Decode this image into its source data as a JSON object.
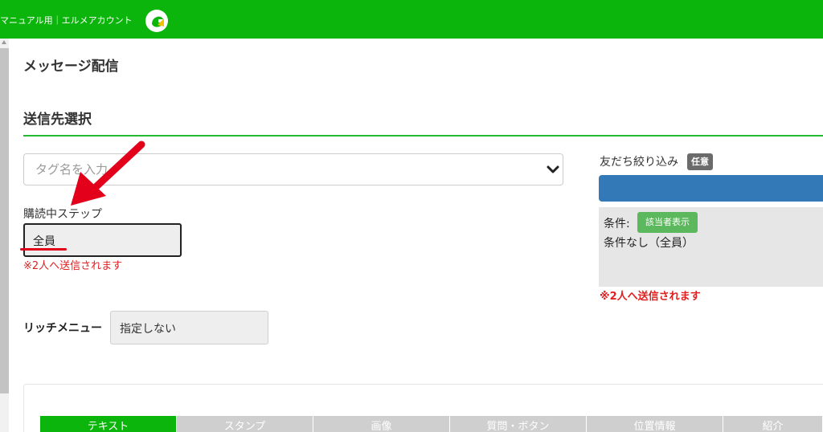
{
  "header": {
    "account_name": "マニュアル用｜エルメアカウント",
    "logo_icon": "l-message-logo-icon",
    "bar_color": "#0bb50b"
  },
  "page": {
    "title": "メッセージ配信",
    "section_title": "送信先選択"
  },
  "recipients": {
    "tag_placeholder": "タグ名を入力",
    "tag_dropdown_icon": "chevron-down-icon",
    "step_label": "購読中ステップ",
    "step_value": "全員",
    "step_note": "※2人へ送信されます"
  },
  "friends_filter": {
    "label": "友だち絞り込み",
    "optional_badge": "任意",
    "condition_label": "条件:",
    "show_targets_button": "該当者表示",
    "condition_value": "条件なし（全員）",
    "note": "※2人へ送信されます",
    "accent_color": "#3479b7"
  },
  "rich_menu": {
    "label": "リッチメニュー",
    "value": "指定しない"
  },
  "composer": {
    "tabs": [
      {
        "label": "テキスト",
        "active": true
      },
      {
        "label": "スタンプ",
        "active": false
      },
      {
        "label": "画像",
        "active": false
      },
      {
        "label": "質問・ボタン",
        "active": false
      },
      {
        "label": "位置情報",
        "active": false
      },
      {
        "label": "紹介",
        "active": false
      }
    ]
  },
  "annotations": {
    "arrow_icon": "red-arrow-icon",
    "highlight_color": "#e3001b"
  }
}
